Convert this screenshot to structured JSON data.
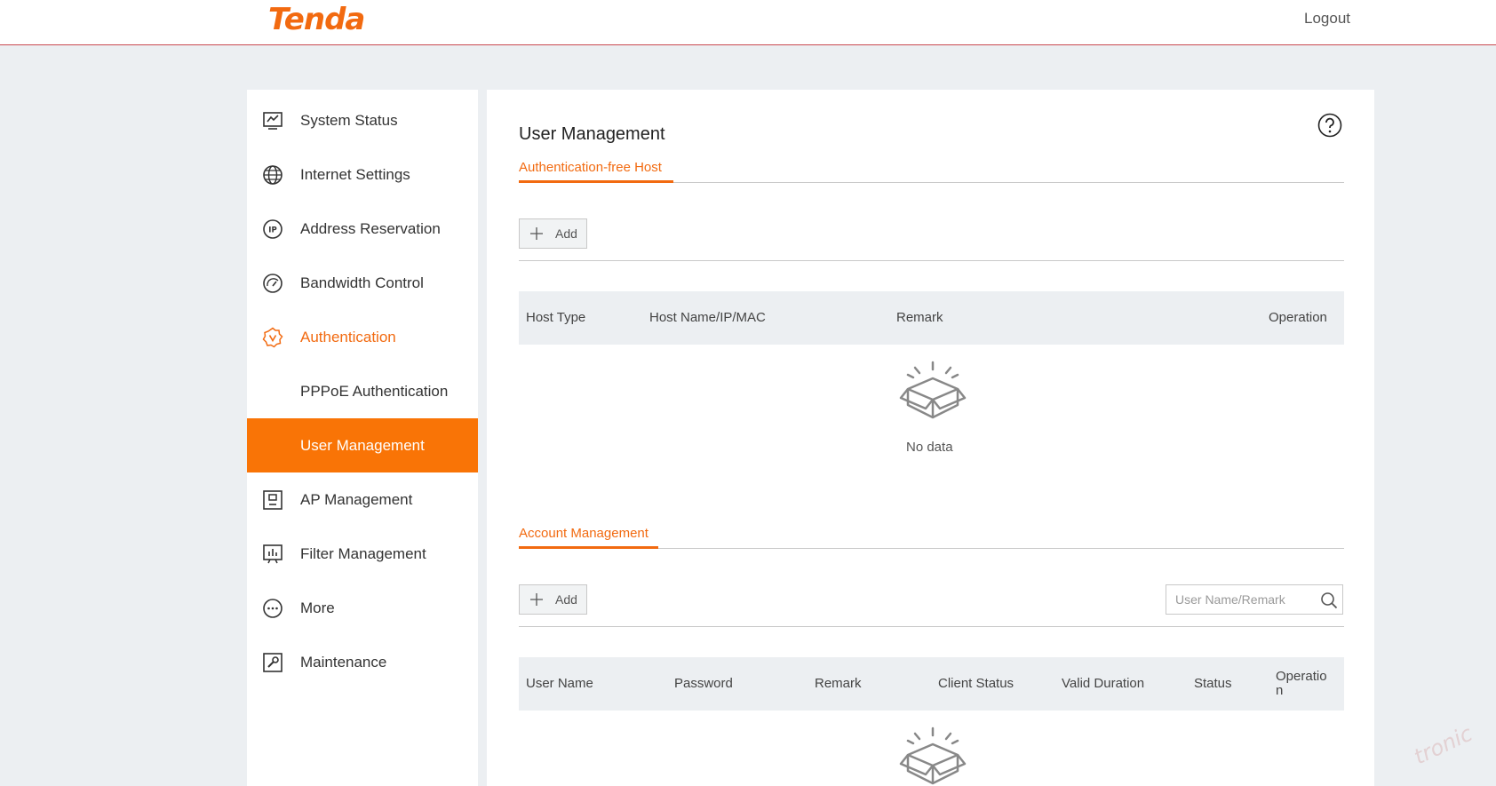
{
  "header": {
    "logo_text": "Tenda",
    "logout_label": "Logout"
  },
  "sidebar": {
    "items": [
      {
        "label": "System Status",
        "icon": "monitor-chart-icon"
      },
      {
        "label": "Internet Settings",
        "icon": "globe-icon"
      },
      {
        "label": "Address Reservation",
        "icon": "ip-icon"
      },
      {
        "label": "Bandwidth Control",
        "icon": "gauge-icon"
      },
      {
        "label": "Authentication",
        "icon": "badge-check-icon",
        "state": "expanded"
      },
      {
        "label": "PPPoE Authentication",
        "icon": "",
        "state": "sub"
      },
      {
        "label": "User Management",
        "icon": "",
        "state": "active"
      },
      {
        "label": "AP Management",
        "icon": "access-point-icon"
      },
      {
        "label": "Filter Management",
        "icon": "filter-board-icon"
      },
      {
        "label": "More",
        "icon": "more-dots-icon"
      },
      {
        "label": "Maintenance",
        "icon": "wrench-icon"
      }
    ]
  },
  "main": {
    "title": "User Management",
    "help_icon": "question-circle-icon",
    "auth_free": {
      "tab_label": "Authentication-free Host",
      "add_label": "Add",
      "columns": [
        "Host Type",
        "Host Name/IP/MAC",
        "Remark",
        "Operation"
      ],
      "empty_text": "No data"
    },
    "accounts": {
      "tab_label": "Account Management",
      "add_label": "Add",
      "search_placeholder": "User Name/Remark",
      "columns": [
        "User Name",
        "Password",
        "Remark",
        "Client Status",
        "Valid Duration",
        "Status",
        "Operatio n"
      ]
    }
  },
  "watermark": "tronic",
  "colors": {
    "accent": "#f26a10",
    "active_bg": "#f97406",
    "page_bg": "#eceff2"
  }
}
